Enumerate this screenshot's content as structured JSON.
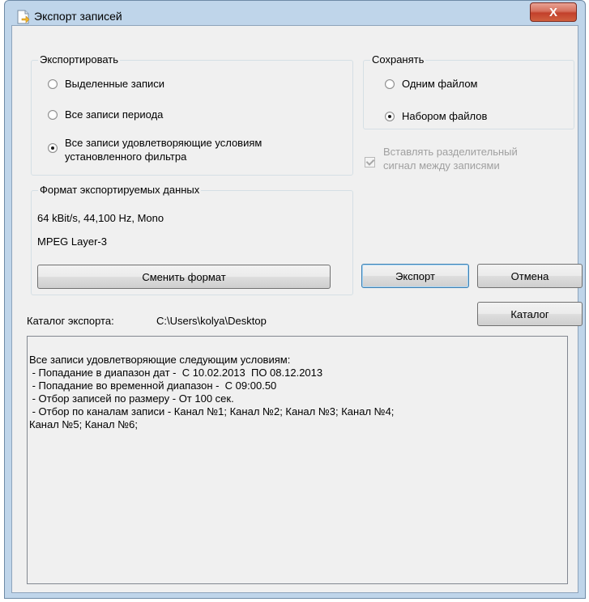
{
  "window": {
    "title": "Экспорт записей",
    "close_label": "X"
  },
  "export_group": {
    "legend": "Экспортировать",
    "options": [
      {
        "label": "Выделенные записи",
        "checked": false
      },
      {
        "label": "Все записи периода",
        "checked": false
      },
      {
        "label_line1": "Все записи удовлетворяющие условиям",
        "label_line2": "установленного фильтра",
        "checked": true
      }
    ]
  },
  "save_group": {
    "legend": "Сохранять",
    "options": [
      {
        "label": "Одним файлом",
        "checked": false
      },
      {
        "label": "Набором файлов",
        "checked": true
      }
    ]
  },
  "separator_checkbox": {
    "label_line1": "Вставлять разделительный",
    "label_line2": "сигнал между записями",
    "checked": true,
    "disabled": true
  },
  "format_group": {
    "legend": "Формат экспортируемых данных",
    "line1": "64 kBit/s, 44,100 Hz, Mono",
    "line2": "MPEG Layer-3",
    "change_button": "Сменить формат"
  },
  "buttons": {
    "export": "Экспорт",
    "cancel": "Отмена",
    "catalog": "Каталог"
  },
  "catalog": {
    "label": "Каталог экспорта:",
    "path": "C:\\Users\\kolya\\Desktop"
  },
  "summary": {
    "lines": [
      "Все записи удовлетворяющие следующим условиям:",
      " - Попадание в диапазон дат -  С 10.02.2013  ПО 08.12.2013",
      " - Попадание во временной диапазон -  С 09:00.50",
      " - Отбор записей по размеру - От 100 сек.",
      " - Отбор по каналам записи - Канал №1; Канал №2; Канал №3; Канал №4;",
      "Канал №5; Канал №6;"
    ]
  },
  "colors": {
    "frame": "#bfd5ea",
    "client": "#f0f0f0",
    "close": "#c2402b",
    "disabled_text": "#a0a0a0"
  }
}
